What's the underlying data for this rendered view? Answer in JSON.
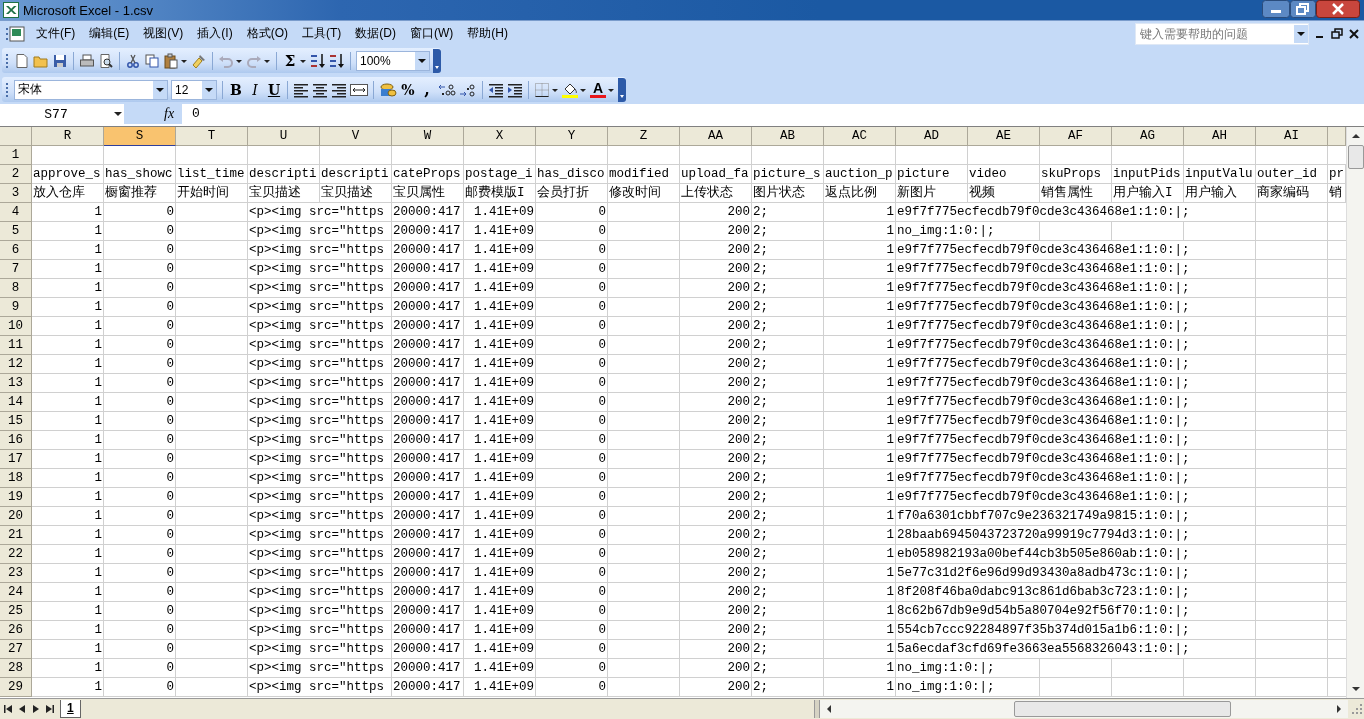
{
  "window": {
    "title": "Microsoft Excel - 1.csv"
  },
  "menu": [
    {
      "label": "文件(F)"
    },
    {
      "label": "编辑(E)"
    },
    {
      "label": "视图(V)"
    },
    {
      "label": "插入(I)"
    },
    {
      "label": "格式(O)"
    },
    {
      "label": "工具(T)"
    },
    {
      "label": "数据(D)"
    },
    {
      "label": "窗口(W)"
    },
    {
      "label": "帮助(H)"
    }
  ],
  "help_box": {
    "placeholder": "键入需要帮助的问题"
  },
  "standard_toolbar": {
    "autosum": "Σ",
    "zoom": "100%"
  },
  "formatting_toolbar": {
    "font": "宋体",
    "size": "12",
    "bold": "B",
    "italic": "I",
    "underline": "U",
    "percent": "%",
    "comma": ",",
    "font_color": "A"
  },
  "formula_bar": {
    "name_box": "S77",
    "function_label": "fx",
    "value": "0"
  },
  "sheet": {
    "columns": [
      {
        "label": "R",
        "selected": false
      },
      {
        "label": "S",
        "selected": true
      },
      {
        "label": "T",
        "selected": false
      },
      {
        "label": "U",
        "selected": false
      },
      {
        "label": "V",
        "selected": false
      },
      {
        "label": "W",
        "selected": false
      },
      {
        "label": "X",
        "selected": false
      },
      {
        "label": "Y",
        "selected": false
      },
      {
        "label": "Z",
        "selected": false
      },
      {
        "label": "AA",
        "selected": false
      },
      {
        "label": "AB",
        "selected": false
      },
      {
        "label": "AC",
        "selected": false
      },
      {
        "label": "AD",
        "selected": false
      },
      {
        "label": "AE",
        "selected": false
      },
      {
        "label": "AF",
        "selected": false
      },
      {
        "label": "AG",
        "selected": false
      },
      {
        "label": "AH",
        "selected": false
      },
      {
        "label": "AI",
        "selected": false
      },
      {
        "selected": false
      }
    ],
    "rows": [
      {
        "header": "1",
        "cells": []
      },
      {
        "header": "2",
        "cells": [
          {
            "text": "approve_s"
          },
          {
            "text": "has_showc"
          },
          {
            "text": "list_time"
          },
          {
            "text": "descripti"
          },
          {
            "text": "descripti"
          },
          {
            "text": "cateProps"
          },
          {
            "text": "postage_i"
          },
          {
            "text": "has_disco"
          },
          {
            "text": "modified"
          },
          {
            "text": "upload_fa"
          },
          {
            "text": "picture_s"
          },
          {
            "text": "auction_p"
          },
          {
            "text": "picture"
          },
          {
            "text": "video"
          },
          {
            "text": "skuProps"
          },
          {
            "text": "inputPids"
          },
          {
            "text": "inputValu"
          },
          {
            "text": "outer_id"
          },
          {
            "text": "pr"
          }
        ]
      },
      {
        "header": "3",
        "cells": [
          {
            "text": "放入仓库"
          },
          {
            "text": "橱窗推荐"
          },
          {
            "text": "开始时间"
          },
          {
            "text": "宝贝描述"
          },
          {
            "text": "宝贝描述"
          },
          {
            "text": "宝贝属性"
          },
          {
            "text": "邮费模版I"
          },
          {
            "text": "会员打折"
          },
          {
            "text": "修改时间"
          },
          {
            "text": "上传状态"
          },
          {
            "text": "图片状态"
          },
          {
            "text": "返点比例"
          },
          {
            "text": "新图片"
          },
          {
            "text": "视频"
          },
          {
            "text": "销售属性"
          },
          {
            "text": "用户输入I"
          },
          {
            "text": "用户输入"
          },
          {
            "text": "商家编码"
          },
          {
            "text": "销"
          }
        ]
      },
      {
        "header": "4",
        "cells": [
          {
            "text": "1",
            "kind": "number"
          },
          {
            "text": "0",
            "kind": "number"
          },
          {},
          {
            "text": "<p><img src=\"https"
          },
          {},
          {
            "text": "20000:417"
          },
          {
            "text": "1.41E+09",
            "kind": "number"
          },
          {
            "text": "0",
            "kind": "number"
          },
          {},
          {
            "text": "200",
            "kind": "number"
          },
          {
            "text": "2;"
          },
          {
            "text": "1",
            "kind": "number"
          },
          {
            "text": "e9f7f775ecfecdb79f0cde3c436468e1:1:0:|;"
          }
        ]
      },
      {
        "header": "5",
        "cells": [
          {
            "text": "1",
            "kind": "number"
          },
          {
            "text": "0",
            "kind": "number"
          },
          {},
          {
            "text": "<p><img src=\"https"
          },
          {},
          {
            "text": "20000:417"
          },
          {
            "text": "1.41E+09",
            "kind": "number"
          },
          {
            "text": "0",
            "kind": "number"
          },
          {},
          {
            "text": "200",
            "kind": "number"
          },
          {
            "text": "2;"
          },
          {
            "text": "1",
            "kind": "number"
          },
          {
            "text": "no_img:1:0:|;"
          }
        ]
      },
      {
        "header": "6",
        "cells": [
          {
            "text": "1",
            "kind": "number"
          },
          {
            "text": "0",
            "kind": "number"
          },
          {},
          {
            "text": "<p><img src=\"https"
          },
          {},
          {
            "text": "20000:417"
          },
          {
            "text": "1.41E+09",
            "kind": "number"
          },
          {
            "text": "0",
            "kind": "number"
          },
          {},
          {
            "text": "200",
            "kind": "number"
          },
          {
            "text": "2;"
          },
          {
            "text": "1",
            "kind": "number"
          },
          {
            "text": "e9f7f775ecfecdb79f0cde3c436468e1:1:0:|;"
          }
        ]
      },
      {
        "header": "7",
        "cells": [
          {
            "text": "1",
            "kind": "number"
          },
          {
            "text": "0",
            "kind": "number"
          },
          {},
          {
            "text": "<p><img src=\"https"
          },
          {},
          {
            "text": "20000:417"
          },
          {
            "text": "1.41E+09",
            "kind": "number"
          },
          {
            "text": "0",
            "kind": "number"
          },
          {},
          {
            "text": "200",
            "kind": "number"
          },
          {
            "text": "2;"
          },
          {
            "text": "1",
            "kind": "number"
          },
          {
            "text": "e9f7f775ecfecdb79f0cde3c436468e1:1:0:|;"
          }
        ]
      },
      {
        "header": "8",
        "cells": [
          {
            "text": "1",
            "kind": "number"
          },
          {
            "text": "0",
            "kind": "number"
          },
          {},
          {
            "text": "<p><img src=\"https"
          },
          {},
          {
            "text": "20000:417"
          },
          {
            "text": "1.41E+09",
            "kind": "number"
          },
          {
            "text": "0",
            "kind": "number"
          },
          {},
          {
            "text": "200",
            "kind": "number"
          },
          {
            "text": "2;"
          },
          {
            "text": "1",
            "kind": "number"
          },
          {
            "text": "e9f7f775ecfecdb79f0cde3c436468e1:1:0:|;"
          }
        ]
      },
      {
        "header": "9",
        "cells": [
          {
            "text": "1",
            "kind": "number"
          },
          {
            "text": "0",
            "kind": "number"
          },
          {},
          {
            "text": "<p><img src=\"https"
          },
          {},
          {
            "text": "20000:417"
          },
          {
            "text": "1.41E+09",
            "kind": "number"
          },
          {
            "text": "0",
            "kind": "number"
          },
          {},
          {
            "text": "200",
            "kind": "number"
          },
          {
            "text": "2;"
          },
          {
            "text": "1",
            "kind": "number"
          },
          {
            "text": "e9f7f775ecfecdb79f0cde3c436468e1:1:0:|;"
          }
        ]
      },
      {
        "header": "10",
        "cells": [
          {
            "text": "1",
            "kind": "number"
          },
          {
            "text": "0",
            "kind": "number"
          },
          {},
          {
            "text": "<p><img src=\"https"
          },
          {},
          {
            "text": "20000:417"
          },
          {
            "text": "1.41E+09",
            "kind": "number"
          },
          {
            "text": "0",
            "kind": "number"
          },
          {},
          {
            "text": "200",
            "kind": "number"
          },
          {
            "text": "2;"
          },
          {
            "text": "1",
            "kind": "number"
          },
          {
            "text": "e9f7f775ecfecdb79f0cde3c436468e1:1:0:|;"
          }
        ]
      },
      {
        "header": "11",
        "cells": [
          {
            "text": "1",
            "kind": "number"
          },
          {
            "text": "0",
            "kind": "number"
          },
          {},
          {
            "text": "<p><img src=\"https"
          },
          {},
          {
            "text": "20000:417"
          },
          {
            "text": "1.41E+09",
            "kind": "number"
          },
          {
            "text": "0",
            "kind": "number"
          },
          {},
          {
            "text": "200",
            "kind": "number"
          },
          {
            "text": "2;"
          },
          {
            "text": "1",
            "kind": "number"
          },
          {
            "text": "e9f7f775ecfecdb79f0cde3c436468e1:1:0:|;"
          }
        ]
      },
      {
        "header": "12",
        "cells": [
          {
            "text": "1",
            "kind": "number"
          },
          {
            "text": "0",
            "kind": "number"
          },
          {},
          {
            "text": "<p><img src=\"https"
          },
          {},
          {
            "text": "20000:417"
          },
          {
            "text": "1.41E+09",
            "kind": "number"
          },
          {
            "text": "0",
            "kind": "number"
          },
          {},
          {
            "text": "200",
            "kind": "number"
          },
          {
            "text": "2;"
          },
          {
            "text": "1",
            "kind": "number"
          },
          {
            "text": "e9f7f775ecfecdb79f0cde3c436468e1:1:0:|;"
          }
        ]
      },
      {
        "header": "13",
        "cells": [
          {
            "text": "1",
            "kind": "number"
          },
          {
            "text": "0",
            "kind": "number"
          },
          {},
          {
            "text": "<p><img src=\"https"
          },
          {},
          {
            "text": "20000:417"
          },
          {
            "text": "1.41E+09",
            "kind": "number"
          },
          {
            "text": "0",
            "kind": "number"
          },
          {},
          {
            "text": "200",
            "kind": "number"
          },
          {
            "text": "2;"
          },
          {
            "text": "1",
            "kind": "number"
          },
          {
            "text": "e9f7f775ecfecdb79f0cde3c436468e1:1:0:|;"
          }
        ]
      },
      {
        "header": "14",
        "cells": [
          {
            "text": "1",
            "kind": "number"
          },
          {
            "text": "0",
            "kind": "number"
          },
          {},
          {
            "text": "<p><img src=\"https"
          },
          {},
          {
            "text": "20000:417"
          },
          {
            "text": "1.41E+09",
            "kind": "number"
          },
          {
            "text": "0",
            "kind": "number"
          },
          {},
          {
            "text": "200",
            "kind": "number"
          },
          {
            "text": "2;"
          },
          {
            "text": "1",
            "kind": "number"
          },
          {
            "text": "e9f7f775ecfecdb79f0cde3c436468e1:1:0:|;"
          }
        ]
      },
      {
        "header": "15",
        "cells": [
          {
            "text": "1",
            "kind": "number"
          },
          {
            "text": "0",
            "kind": "number"
          },
          {},
          {
            "text": "<p><img src=\"https"
          },
          {},
          {
            "text": "20000:417"
          },
          {
            "text": "1.41E+09",
            "kind": "number"
          },
          {
            "text": "0",
            "kind": "number"
          },
          {},
          {
            "text": "200",
            "kind": "number"
          },
          {
            "text": "2;"
          },
          {
            "text": "1",
            "kind": "number"
          },
          {
            "text": "e9f7f775ecfecdb79f0cde3c436468e1:1:0:|;"
          }
        ]
      },
      {
        "header": "16",
        "cells": [
          {
            "text": "1",
            "kind": "number"
          },
          {
            "text": "0",
            "kind": "number"
          },
          {},
          {
            "text": "<p><img src=\"https"
          },
          {},
          {
            "text": "20000:417"
          },
          {
            "text": "1.41E+09",
            "kind": "number"
          },
          {
            "text": "0",
            "kind": "number"
          },
          {},
          {
            "text": "200",
            "kind": "number"
          },
          {
            "text": "2;"
          },
          {
            "text": "1",
            "kind": "number"
          },
          {
            "text": "e9f7f775ecfecdb79f0cde3c436468e1:1:0:|;"
          }
        ]
      },
      {
        "header": "17",
        "cells": [
          {
            "text": "1",
            "kind": "number"
          },
          {
            "text": "0",
            "kind": "number"
          },
          {},
          {
            "text": "<p><img src=\"https"
          },
          {},
          {
            "text": "20000:417"
          },
          {
            "text": "1.41E+09",
            "kind": "number"
          },
          {
            "text": "0",
            "kind": "number"
          },
          {},
          {
            "text": "200",
            "kind": "number"
          },
          {
            "text": "2;"
          },
          {
            "text": "1",
            "kind": "number"
          },
          {
            "text": "e9f7f775ecfecdb79f0cde3c436468e1:1:0:|;"
          }
        ]
      },
      {
        "header": "18",
        "cells": [
          {
            "text": "1",
            "kind": "number"
          },
          {
            "text": "0",
            "kind": "number"
          },
          {},
          {
            "text": "<p><img src=\"https"
          },
          {},
          {
            "text": "20000:417"
          },
          {
            "text": "1.41E+09",
            "kind": "number"
          },
          {
            "text": "0",
            "kind": "number"
          },
          {},
          {
            "text": "200",
            "kind": "number"
          },
          {
            "text": "2;"
          },
          {
            "text": "1",
            "kind": "number"
          },
          {
            "text": "e9f7f775ecfecdb79f0cde3c436468e1:1:0:|;"
          }
        ]
      },
      {
        "header": "19",
        "cells": [
          {
            "text": "1",
            "kind": "number"
          },
          {
            "text": "0",
            "kind": "number"
          },
          {},
          {
            "text": "<p><img src=\"https"
          },
          {},
          {
            "text": "20000:417"
          },
          {
            "text": "1.41E+09",
            "kind": "number"
          },
          {
            "text": "0",
            "kind": "number"
          },
          {},
          {
            "text": "200",
            "kind": "number"
          },
          {
            "text": "2;"
          },
          {
            "text": "1",
            "kind": "number"
          },
          {
            "text": "e9f7f775ecfecdb79f0cde3c436468e1:1:0:|;"
          }
        ]
      },
      {
        "header": "20",
        "cells": [
          {
            "text": "1",
            "kind": "number"
          },
          {
            "text": "0",
            "kind": "number"
          },
          {},
          {
            "text": "<p><img src=\"https"
          },
          {},
          {
            "text": "20000:417"
          },
          {
            "text": "1.41E+09",
            "kind": "number"
          },
          {
            "text": "0",
            "kind": "number"
          },
          {},
          {
            "text": "200",
            "kind": "number"
          },
          {
            "text": "2;"
          },
          {
            "text": "1",
            "kind": "number"
          },
          {
            "text": "f70a6301cbbf707c9e236321749a9815:1:0:|;"
          }
        ]
      },
      {
        "header": "21",
        "cells": [
          {
            "text": "1",
            "kind": "number"
          },
          {
            "text": "0",
            "kind": "number"
          },
          {},
          {
            "text": "<p><img src=\"https"
          },
          {},
          {
            "text": "20000:417"
          },
          {
            "text": "1.41E+09",
            "kind": "number"
          },
          {
            "text": "0",
            "kind": "number"
          },
          {},
          {
            "text": "200",
            "kind": "number"
          },
          {
            "text": "2;"
          },
          {
            "text": "1",
            "kind": "number"
          },
          {
            "text": "28baab6945043723720a99919c7794d3:1:0:|;"
          }
        ]
      },
      {
        "header": "22",
        "cells": [
          {
            "text": "1",
            "kind": "number"
          },
          {
            "text": "0",
            "kind": "number"
          },
          {},
          {
            "text": "<p><img src=\"https"
          },
          {},
          {
            "text": "20000:417"
          },
          {
            "text": "1.41E+09",
            "kind": "number"
          },
          {
            "text": "0",
            "kind": "number"
          },
          {},
          {
            "text": "200",
            "kind": "number"
          },
          {
            "text": "2;"
          },
          {
            "text": "1",
            "kind": "number"
          },
          {
            "text": "eb058982193a00bef44cb3b505e860ab:1:0:|;"
          }
        ]
      },
      {
        "header": "23",
        "cells": [
          {
            "text": "1",
            "kind": "number"
          },
          {
            "text": "0",
            "kind": "number"
          },
          {},
          {
            "text": "<p><img src=\"https"
          },
          {},
          {
            "text": "20000:417"
          },
          {
            "text": "1.41E+09",
            "kind": "number"
          },
          {
            "text": "0",
            "kind": "number"
          },
          {},
          {
            "text": "200",
            "kind": "number"
          },
          {
            "text": "2;"
          },
          {
            "text": "1",
            "kind": "number"
          },
          {
            "text": "5e77c31d2f6e96d99d93430a8adb473c:1:0:|;"
          }
        ]
      },
      {
        "header": "24",
        "cells": [
          {
            "text": "1",
            "kind": "number"
          },
          {
            "text": "0",
            "kind": "number"
          },
          {},
          {
            "text": "<p><img src=\"https"
          },
          {},
          {
            "text": "20000:417"
          },
          {
            "text": "1.41E+09",
            "kind": "number"
          },
          {
            "text": "0",
            "kind": "number"
          },
          {},
          {
            "text": "200",
            "kind": "number"
          },
          {
            "text": "2;"
          },
          {
            "text": "1",
            "kind": "number"
          },
          {
            "text": "8f208f46ba0dabc913c861d6bab3c723:1:0:|;"
          }
        ]
      },
      {
        "header": "25",
        "cells": [
          {
            "text": "1",
            "kind": "number"
          },
          {
            "text": "0",
            "kind": "number"
          },
          {},
          {
            "text": "<p><img src=\"https"
          },
          {},
          {
            "text": "20000:417"
          },
          {
            "text": "1.41E+09",
            "kind": "number"
          },
          {
            "text": "0",
            "kind": "number"
          },
          {},
          {
            "text": "200",
            "kind": "number"
          },
          {
            "text": "2;"
          },
          {
            "text": "1",
            "kind": "number"
          },
          {
            "text": "8c62b67db9e9d54b5a80704e92f56f70:1:0:|;"
          }
        ]
      },
      {
        "header": "26",
        "cells": [
          {
            "text": "1",
            "kind": "number"
          },
          {
            "text": "0",
            "kind": "number"
          },
          {},
          {
            "text": "<p><img src=\"https"
          },
          {},
          {
            "text": "20000:417"
          },
          {
            "text": "1.41E+09",
            "kind": "number"
          },
          {
            "text": "0",
            "kind": "number"
          },
          {},
          {
            "text": "200",
            "kind": "number"
          },
          {
            "text": "2;"
          },
          {
            "text": "1",
            "kind": "number"
          },
          {
            "text": "554cb7ccc92284897f35b374d015a1b6:1:0:|;"
          }
        ]
      },
      {
        "header": "27",
        "cells": [
          {
            "text": "1",
            "kind": "number"
          },
          {
            "text": "0",
            "kind": "number"
          },
          {},
          {
            "text": "<p><img src=\"https"
          },
          {},
          {
            "text": "20000:417"
          },
          {
            "text": "1.41E+09",
            "kind": "number"
          },
          {
            "text": "0",
            "kind": "number"
          },
          {},
          {
            "text": "200",
            "kind": "number"
          },
          {
            "text": "2;"
          },
          {
            "text": "1",
            "kind": "number"
          },
          {
            "text": "5a6ecdaf3cfd69fe3663ea5568326043:1:0:|;"
          }
        ]
      },
      {
        "header": "28",
        "cells": [
          {
            "text": "1",
            "kind": "number"
          },
          {
            "text": "0",
            "kind": "number"
          },
          {},
          {
            "text": "<p><img src=\"https"
          },
          {},
          {
            "text": "20000:417"
          },
          {
            "text": "1.41E+09",
            "kind": "number"
          },
          {
            "text": "0",
            "kind": "number"
          },
          {},
          {
            "text": "200",
            "kind": "number"
          },
          {
            "text": "2;"
          },
          {
            "text": "1",
            "kind": "number"
          },
          {
            "text": "no_img:1:0:|;"
          }
        ]
      },
      {
        "header": "29",
        "cells": [
          {
            "text": "1",
            "kind": "number"
          },
          {
            "text": "0",
            "kind": "number"
          },
          {},
          {
            "text": "<p><img src=\"https"
          },
          {},
          {
            "text": "20000:417"
          },
          {
            "text": "1.41E+09",
            "kind": "number"
          },
          {
            "text": "0",
            "kind": "number"
          },
          {},
          {
            "text": "200",
            "kind": "number"
          },
          {
            "text": "2;"
          },
          {
            "text": "1",
            "kind": "number"
          },
          {
            "text": "no_img:1:0:|;"
          }
        ]
      }
    ]
  },
  "sheet_tabs": [
    {
      "label": "1",
      "selected": true
    }
  ]
}
